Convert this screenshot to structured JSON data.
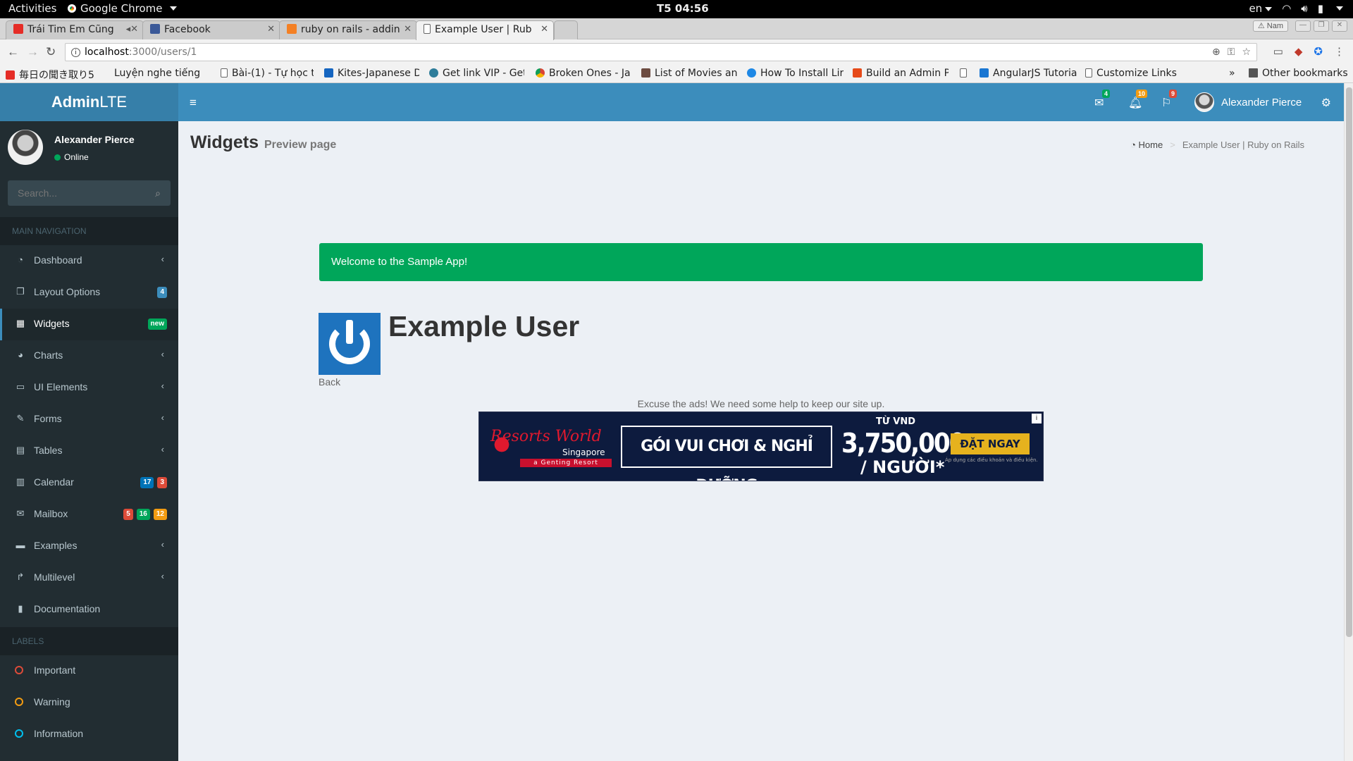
{
  "os_bar": {
    "activities": "Activities",
    "app_name": "Google Chrome",
    "clock": "T5 04:56",
    "lang": "en"
  },
  "browser": {
    "tabs": [
      {
        "title": "Trái Tim Em Cũng",
        "icon_color": "#e52d27"
      },
      {
        "title": "Facebook",
        "icon_color": "#3b5998"
      },
      {
        "title": "ruby on rails - addin",
        "icon_color": "#f48024"
      },
      {
        "title": "Example User | Rub",
        "icon_color": "#ffffff"
      }
    ],
    "profile": "Nam",
    "url_host": "localhost",
    "url_path": ":3000/users/1",
    "bookmarks": [
      "毎日の聞き取り5",
      "Luyện nghe tiếng",
      "Bài-(1) - Tự học ti",
      "Kites-Japanese D",
      "Get link VIP - Get",
      "Broken Ones - Ja",
      "List of Movies anc",
      "How To Install Lir",
      "Build an Admin Pa",
      "",
      "AngularJS Tutoria",
      "Customize Links"
    ],
    "bookmarks_more": "»",
    "other_bookmarks": "Other bookmarks"
  },
  "header": {
    "logo_bold": "Admin",
    "logo_rest": "LTE",
    "messages_count": "4",
    "notifications_count": "10",
    "tasks_count": "9",
    "user_name": "Alexander Pierce",
    "colors": {
      "primary": "#3c8dbc",
      "logo": "#367fa9"
    }
  },
  "sidebar": {
    "user_name": "Alexander Pierce",
    "status": "Online",
    "search_placeholder": "Search...",
    "main_header": "MAIN NAVIGATION",
    "items": [
      {
        "label": "Dashboard",
        "icon": "dashboard-icon"
      },
      {
        "label": "Layout Options",
        "icon": "files-icon",
        "badge": "4"
      },
      {
        "label": "Widgets",
        "icon": "th-icon",
        "badge": "new"
      },
      {
        "label": "Charts",
        "icon": "pie-chart-icon"
      },
      {
        "label": "UI Elements",
        "icon": "laptop-icon"
      },
      {
        "label": "Forms",
        "icon": "edit-icon"
      },
      {
        "label": "Tables",
        "icon": "table-icon"
      },
      {
        "label": "Calendar",
        "icon": "calendar-icon",
        "badges": [
          "17",
          "3"
        ]
      },
      {
        "label": "Mailbox",
        "icon": "envelope-icon",
        "badges": [
          "5",
          "16",
          "12"
        ]
      },
      {
        "label": "Examples",
        "icon": "folder-icon"
      },
      {
        "label": "Multilevel",
        "icon": "share-icon"
      },
      {
        "label": "Documentation",
        "icon": "book-icon"
      }
    ],
    "labels_header": "LABELS",
    "labels": [
      {
        "label": "Important",
        "color": "#dd4b39"
      },
      {
        "label": "Warning",
        "color": "#f39c12"
      },
      {
        "label": "Information",
        "color": "#00c0ef"
      }
    ]
  },
  "content": {
    "title": "Widgets",
    "subtitle": "Preview page",
    "breadcrumb_home": "Home",
    "breadcrumb_current": "Example User | Ruby on Rails",
    "flash": "Welcome to the Sample App!",
    "user_heading": "Example User",
    "back_link": "Back",
    "ads_note": "Excuse the ads! We need some help to keep our site up.",
    "ad": {
      "brand": "Resorts World",
      "location": "Singapore",
      "tagline": "a Genting Resort",
      "promo": "GÓI VUI CHƠI & NGHỈ DƯỠNG",
      "from": "TỪ VND",
      "price": "3,750,000",
      "per": "/ NGƯỜI*",
      "cta": "ĐẶT NGAY",
      "fine_print": "Áp dụng các điều khoản và điều kiện.",
      "info": "i"
    }
  }
}
